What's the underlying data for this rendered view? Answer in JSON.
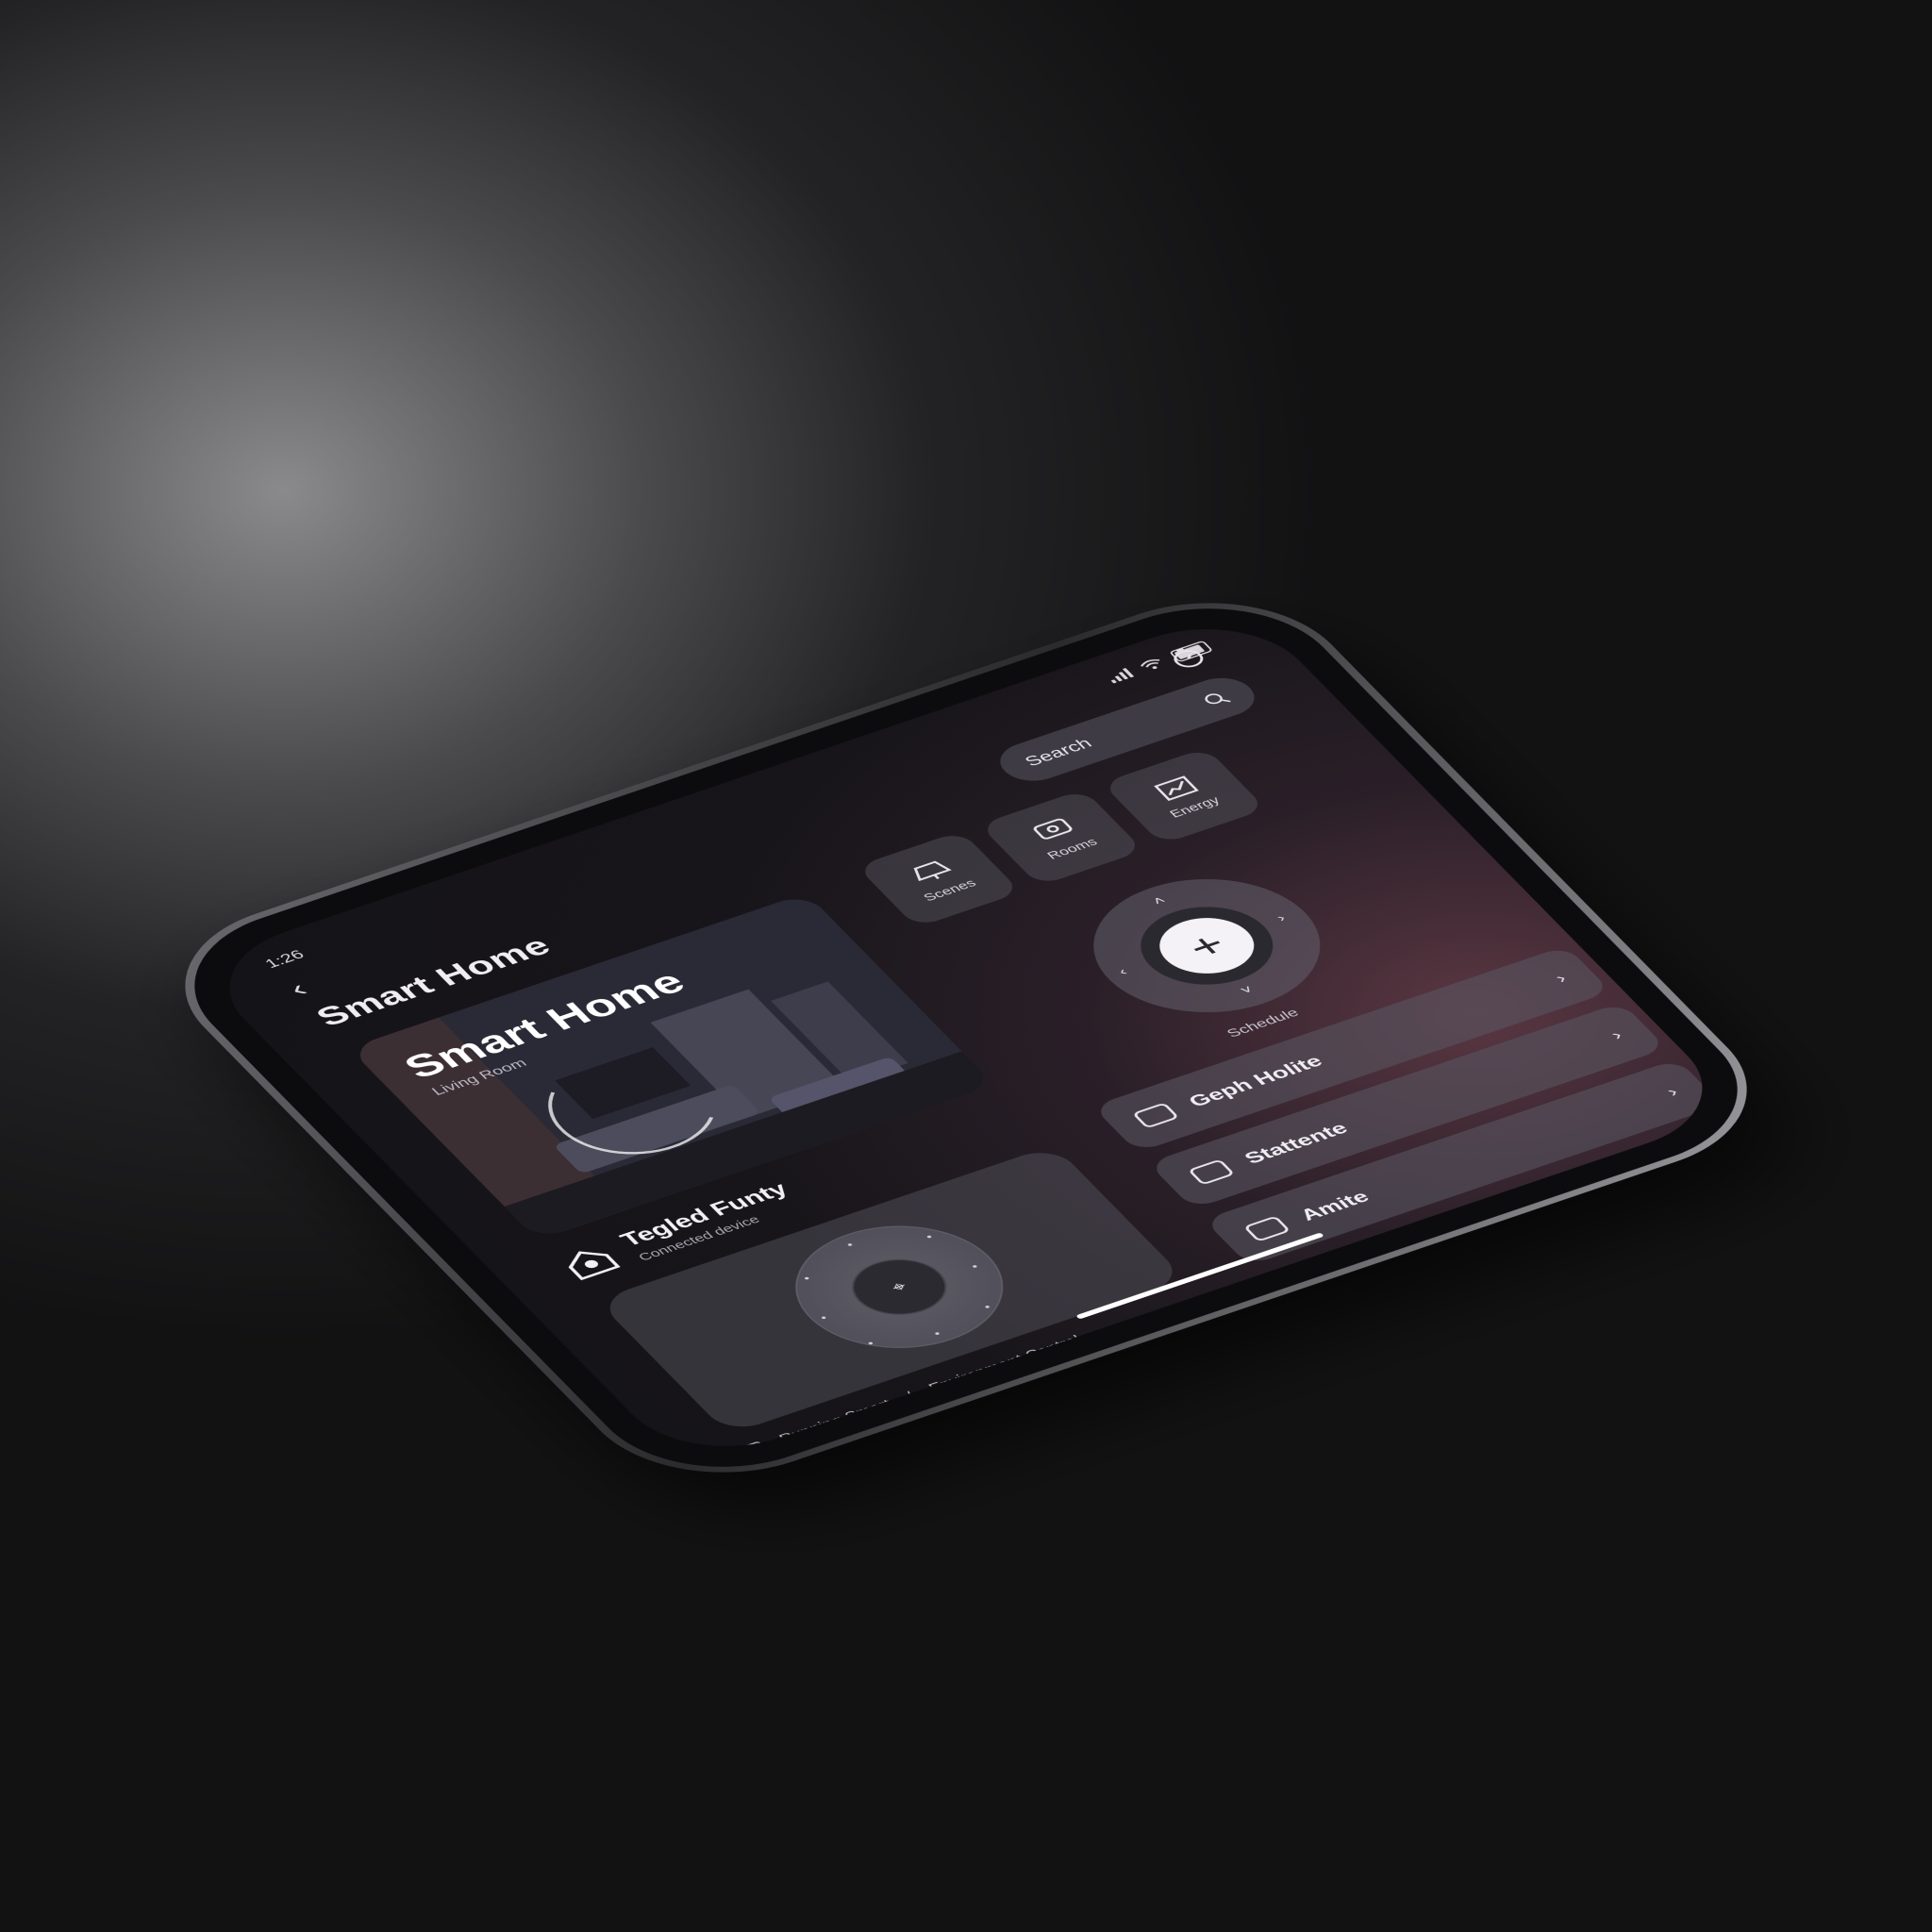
{
  "status_bar": {
    "time": "1:26"
  },
  "header": {
    "back_icon": "chevron-left-icon",
    "title": "Smart Home"
  },
  "hero": {
    "title": "Smart Home",
    "subtitle": "Living Room"
  },
  "device": {
    "icon": "home-icon",
    "name": "Tegled Funty",
    "subtitle": "Connected device"
  },
  "dial": {
    "center_icon": "crosshair-icon"
  },
  "footer": {
    "left_label": "Running Smart",
    "right_label": "Environment Control"
  },
  "search": {
    "label": "Search",
    "icon": "search-icon"
  },
  "quick_tiles": [
    {
      "icon": "lamp-icon",
      "label": "Scenes"
    },
    {
      "icon": "chat-icon",
      "label": "Rooms"
    },
    {
      "icon": "chart-icon",
      "label": "Energy"
    }
  ],
  "remote": {
    "center_icon": "plus-icon",
    "label": "Schedule"
  },
  "scenes": [
    {
      "icon": "sofa-icon",
      "label": "Geph Holite"
    },
    {
      "icon": "tv-icon",
      "label": "Stattente"
    },
    {
      "icon": "camera-icon",
      "label": "Amite"
    }
  ],
  "colors": {
    "accent_glow": "#5a3742",
    "screen_bg": "#141317",
    "card_bg": "#504e58"
  }
}
